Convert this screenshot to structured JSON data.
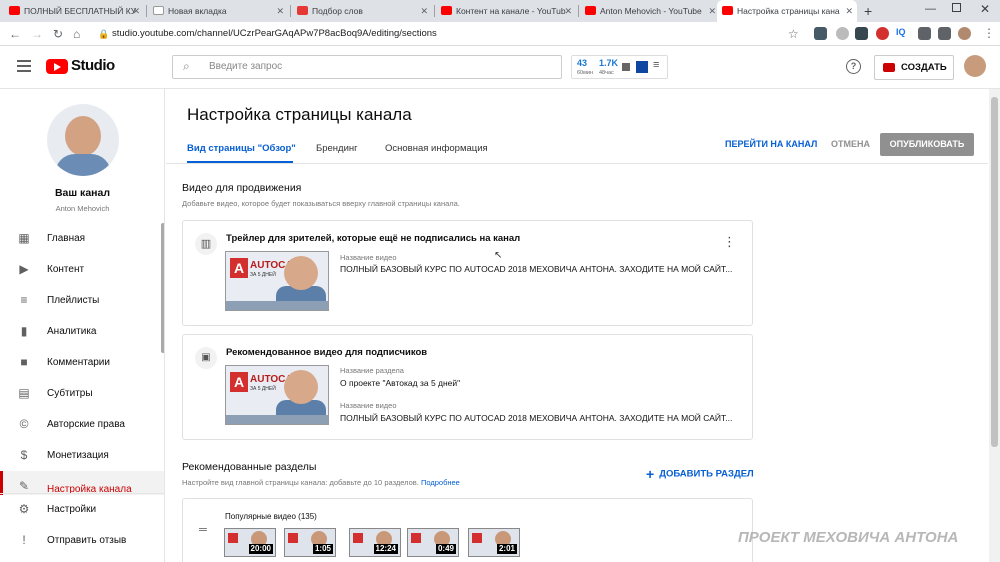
{
  "browser": {
    "tabs": [
      {
        "title": "ПОЛНЫЙ БЕСПЛАТНЫЙ КУ",
        "active": false,
        "favicon_color": "#ff0000"
      },
      {
        "title": "Новая вкладка",
        "active": false,
        "favicon_color": "#ffffff"
      },
      {
        "title": "Подбор слов",
        "active": false,
        "favicon_color": "#e53935"
      },
      {
        "title": "Контент на канале - YouTub",
        "active": false,
        "favicon_color": "#ff0000"
      },
      {
        "title": "Anton Mehovich - YouTube",
        "active": false,
        "favicon_color": "#ff0000"
      },
      {
        "title": "Настройка страницы кана",
        "active": true,
        "favicon_color": "#ff0000"
      }
    ],
    "url": "studio.youtube.com/channel/UCzrPearGAqAPw7P8acBoq9A/editing/sections"
  },
  "header": {
    "logo_text": "Studio",
    "search_placeholder": "Введите запрос",
    "stats": [
      {
        "value": "43",
        "label": "60мин"
      },
      {
        "value": "1.7K",
        "label": "48час"
      }
    ],
    "create_label": "СОЗДАТЬ"
  },
  "sidebar": {
    "channel_title": "Ваш канал",
    "channel_name": "Anton Mehovich",
    "items": [
      {
        "label": "Главная",
        "icon": "dashboard-icon"
      },
      {
        "label": "Контент",
        "icon": "video-library-icon"
      },
      {
        "label": "Плейлисты",
        "icon": "playlist-icon"
      },
      {
        "label": "Аналитика",
        "icon": "analytics-icon"
      },
      {
        "label": "Комментарии",
        "icon": "comments-icon"
      },
      {
        "label": "Субтитры",
        "icon": "subtitles-icon"
      },
      {
        "label": "Авторские права",
        "icon": "copyright-icon"
      },
      {
        "label": "Монетизация",
        "icon": "dollar-icon"
      },
      {
        "label": "Настройка канала",
        "icon": "customization-icon",
        "active": true
      }
    ],
    "bottom_items": [
      {
        "label": "Настройки",
        "icon": "gear-icon"
      },
      {
        "label": "Отправить отзыв",
        "icon": "feedback-icon"
      }
    ]
  },
  "page": {
    "title": "Настройка страницы канала",
    "tabs": [
      {
        "label": "Вид страницы \"Обзор\"",
        "active": true
      },
      {
        "label": "Брендинг",
        "active": false
      },
      {
        "label": "Основная информация",
        "active": false
      }
    ],
    "actions": {
      "go_to_channel": "ПЕРЕЙТИ НА КАНАЛ",
      "cancel": "ОТМЕНА",
      "publish": "ОПУБЛИКОВАТЬ"
    },
    "promo_section": {
      "title": "Видео для продвижения",
      "description": "Добавьте видео, которое будет показываться вверху главной страницы канала."
    },
    "trailer_card": {
      "title": "Трейлер для зрителей, которые ещё не подписались на канал",
      "video_label": "Название видео",
      "video_title": "ПОЛНЫЙ БАЗОВЫЙ КУРС ПО AUTOCAD 2018 МЕХОВИЧА АНТОНА. ЗАХОДИТЕ НА МОЙ САЙТ..."
    },
    "featured_card": {
      "title": "Рекомендованное видео для подписчиков",
      "section_label": "Название раздела",
      "section_value": "О проекте \"Автокад за 5 дней\"",
      "video_label": "Название видео",
      "video_title": "ПОЛНЫЙ БАЗОВЫЙ КУРС ПО AUTOCAD 2018 МЕХОВИЧА АНТОНА. ЗАХОДИТЕ НА МОЙ САЙТ..."
    },
    "thumbnail": {
      "brand": "AUTOCAD",
      "subtitle": "ЗА 5 ДНЕЙ"
    },
    "sections": {
      "title": "Рекомендованные разделы",
      "description": "Настройте вид главной страницы канала: добавьте до 10 разделов.",
      "more_link": "Подробнее",
      "add_label": "ДОБАВИТЬ РАЗДЕЛ",
      "popular": {
        "title": "Популярные видео",
        "count": "(135)",
        "durations": [
          "20:00",
          "1:05",
          "12:24",
          "0:49",
          "2:01"
        ]
      }
    },
    "watermark": "ПРОЕКТ МЕХОВИЧА АНТОНА"
  },
  "colors": {
    "accent_blue": "#065fd4",
    "youtube_red": "#ff0000",
    "publish_bg": "#909090",
    "active_tab_underline": "#065fd4"
  }
}
